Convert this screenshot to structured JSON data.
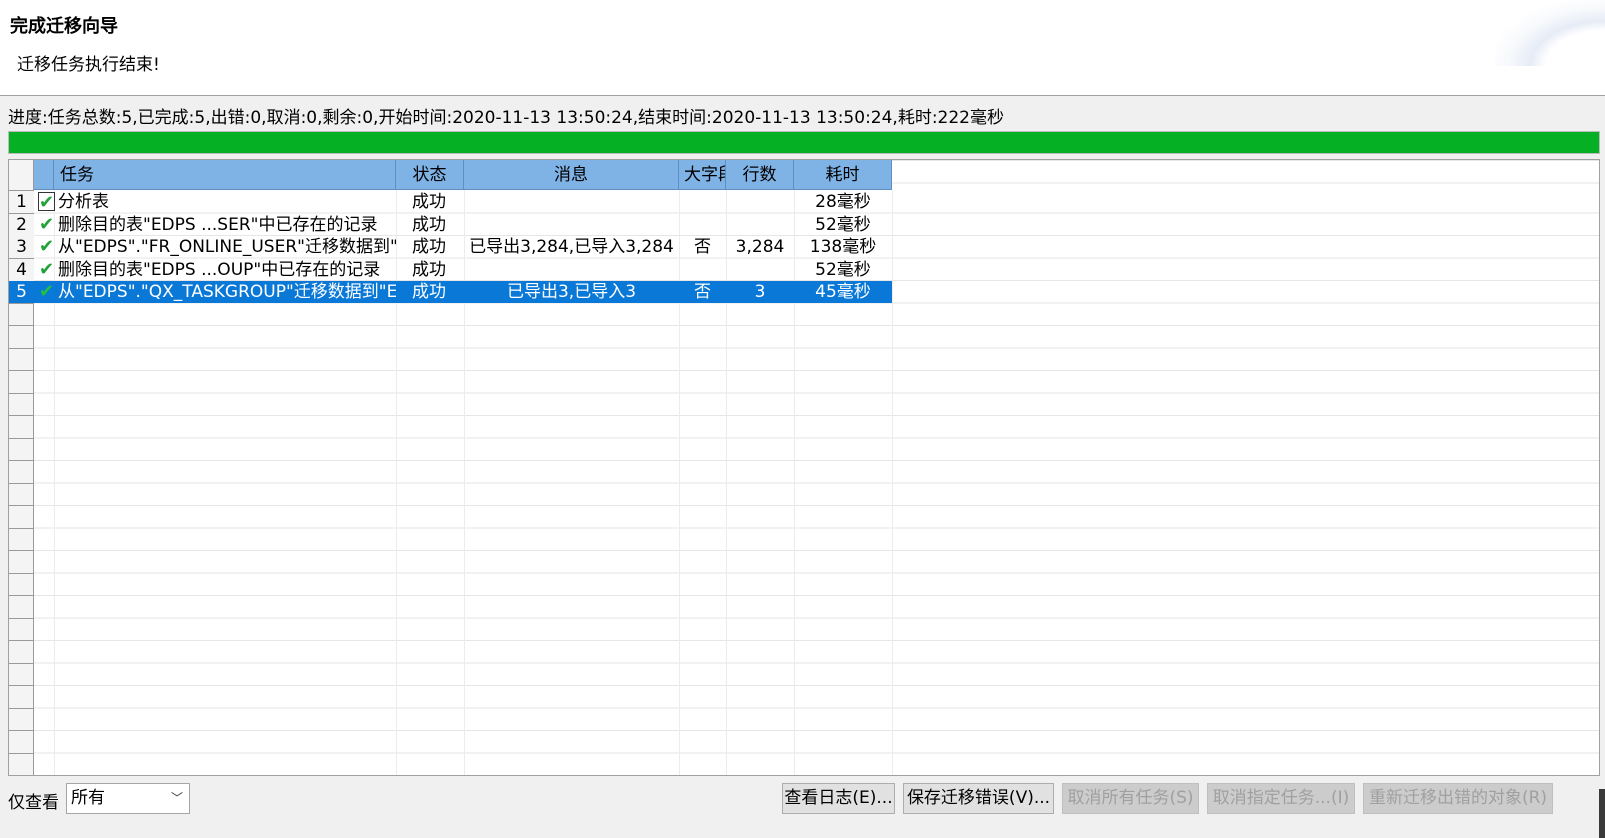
{
  "header": {
    "title": "完成迁移向导",
    "subtitle": "迁移任务执行结束!"
  },
  "progress": {
    "text": "进度:任务总数:5,已完成:5,出错:0,取消:0,剩余:0,开始时间:2020-11-13 13:50:24,结束时间:2020-11-13 13:50:24,耗时:222毫秒",
    "percent": 100,
    "color": "#06b025"
  },
  "table": {
    "columns": [
      "任务",
      "状态",
      "消息",
      "大字段",
      "行数",
      "耗时"
    ],
    "rows": [
      {
        "num": "1",
        "task": "分析表",
        "status": "成功",
        "message": "",
        "lob": "",
        "rows": "",
        "time": "28毫秒"
      },
      {
        "num": "2",
        "task": "删除目的表\"EDPS ...SER\"中已存在的记录",
        "status": "成功",
        "message": "",
        "lob": "",
        "rows": "",
        "time": "52毫秒"
      },
      {
        "num": "3",
        "task": "从\"EDPS\".\"FR_ONLINE_USER\"迁移数据到\"EDPS\".\"FR_ONLINE_USER\"",
        "status": "成功",
        "message": "已导出3,284,已导入3,284",
        "lob": "否",
        "rows": "3,284",
        "time": "138毫秒"
      },
      {
        "num": "4",
        "task": "删除目的表\"EDPS ...OUP\"中已存在的记录",
        "status": "成功",
        "message": "",
        "lob": "",
        "rows": "",
        "time": "52毫秒"
      },
      {
        "num": "5",
        "task": "从\"EDPS\".\"QX_TASKGROUP\"迁移数据到\"EDPS\".\"QX_TASKGROUP\"",
        "status": "成功",
        "message": "已导出3,已导入3",
        "lob": "否",
        "rows": "3",
        "time": "45毫秒"
      }
    ],
    "selected_row": 5,
    "selection_color": "#0a78d7",
    "header_color": "#7fb2e5",
    "check_icon": "check-icon"
  },
  "footer": {
    "filter_label": "仅查看",
    "filter_value": "所有",
    "buttons": {
      "view_log": "查看日志(E)...",
      "save_errors": "保存迁移错误(V)...",
      "cancel_all": "取消所有任务(S)",
      "cancel_selected": "取消指定任务...(I)",
      "remigrate": "重新迁移出错的对象(R)"
    }
  }
}
